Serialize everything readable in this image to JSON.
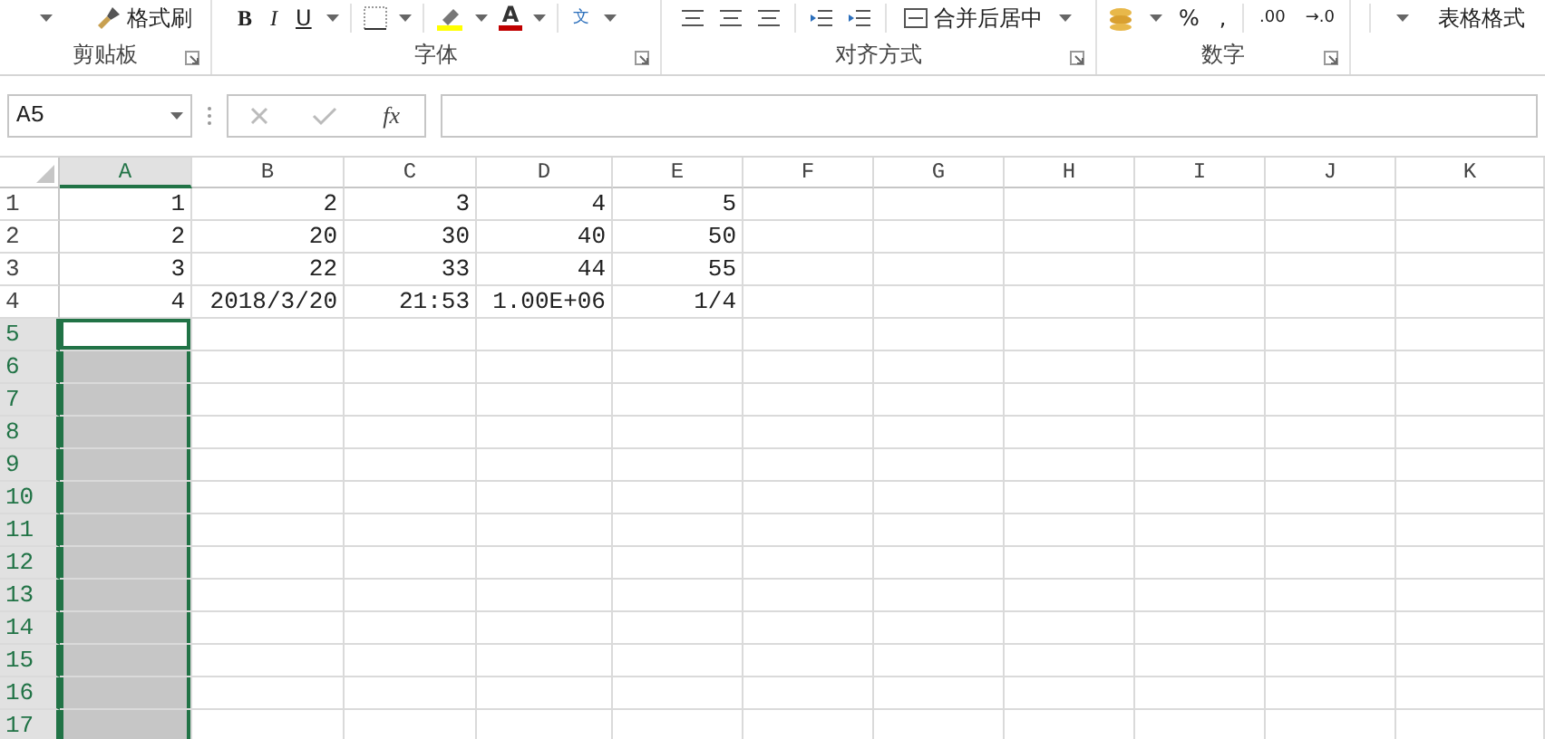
{
  "ribbon": {
    "groups": [
      {
        "label": "剪贴板",
        "launcher": true,
        "items": [
          "格式刷"
        ]
      },
      {
        "label": "字体",
        "launcher": true,
        "items": [
          "B",
          "I",
          "U",
          "A",
          "文"
        ]
      },
      {
        "label": "对齐方式",
        "launcher": true,
        "items": [
          "合并后居中"
        ]
      },
      {
        "label": "数字",
        "launcher": true,
        "items": [
          "%",
          ",",
          ".00",
          "→.0"
        ]
      },
      {
        "items": [
          "表格格式"
        ]
      }
    ]
  },
  "formula_bar": {
    "name_box": "A5",
    "function_button": "fx"
  },
  "sheet": {
    "columns": [
      {
        "label": "A",
        "selected": true
      },
      {
        "label": "B",
        "selected": false
      },
      {
        "label": "C",
        "selected": false
      },
      {
        "label": "D",
        "selected": false
      },
      {
        "label": "E",
        "selected": false
      },
      {
        "label": "F",
        "selected": false
      },
      {
        "label": "G",
        "selected": false
      },
      {
        "label": "H",
        "selected": false
      },
      {
        "label": "I",
        "selected": false
      },
      {
        "label": "J",
        "selected": false
      },
      {
        "label": "K",
        "selected": false
      }
    ],
    "rows": [
      {
        "label": "1",
        "selected": false,
        "active": false,
        "cells": [
          "1",
          "2",
          "3",
          "4",
          "5"
        ]
      },
      {
        "label": "2",
        "selected": false,
        "active": false,
        "cells": [
          "2",
          "20",
          "30",
          "40",
          "50"
        ]
      },
      {
        "label": "3",
        "selected": false,
        "active": false,
        "cells": [
          "3",
          "22",
          "33",
          "44",
          "55"
        ]
      },
      {
        "label": "4",
        "selected": false,
        "active": false,
        "cells": [
          "4",
          "2018/3/20",
          "21:53",
          "1.00E+06",
          "1/4"
        ]
      },
      {
        "label": "5",
        "selected": true,
        "active": true
      },
      {
        "label": "6",
        "selected": true,
        "active": false
      },
      {
        "label": "7",
        "selected": true,
        "active": false
      },
      {
        "label": "8",
        "selected": true,
        "active": false
      },
      {
        "label": "9",
        "selected": true,
        "active": false
      },
      {
        "label": "10",
        "selected": true,
        "active": false
      },
      {
        "label": "11",
        "selected": true,
        "active": false
      },
      {
        "label": "12",
        "selected": true,
        "active": false
      },
      {
        "label": "13",
        "selected": true,
        "active": false
      },
      {
        "label": "14",
        "selected": true,
        "active": false
      },
      {
        "label": "15",
        "selected": true,
        "active": false
      },
      {
        "label": "16",
        "selected": true,
        "active": false
      },
      {
        "label": "17",
        "selected": true,
        "active": false
      }
    ]
  }
}
